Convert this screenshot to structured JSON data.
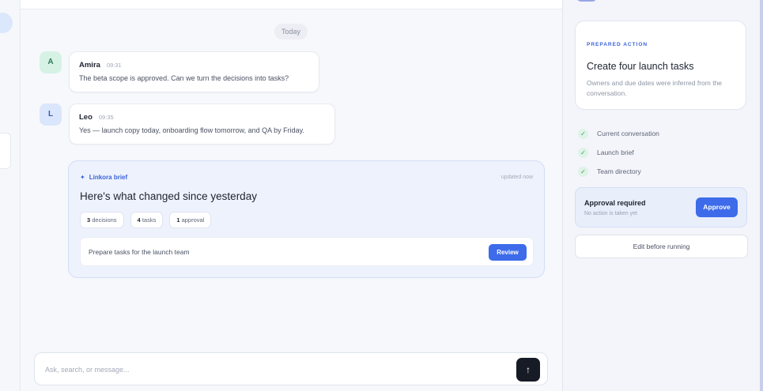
{
  "chat": {
    "day_label": "Today",
    "messages": [
      {
        "avatar": "A",
        "name": "Amira",
        "time": "09:31",
        "text": "The beta scope is approved. Can we turn the decisions into tasks?"
      },
      {
        "avatar": "L",
        "name": "Leo",
        "time": "09:35",
        "text": "Yes — launch copy today, onboarding flow tomorrow, and QA by Friday."
      }
    ],
    "brief": {
      "icon": "sparkle-icon",
      "label": "Linkora brief",
      "updated": "updated now",
      "title": "Here's what changed since yesterday",
      "chips": [
        {
          "count": "3",
          "label": "decisions"
        },
        {
          "count": "4",
          "label": "tasks"
        },
        {
          "count": "1",
          "label": "approval"
        }
      ],
      "action_text": "Prepare tasks for the launch team",
      "review_label": "Review"
    },
    "composer": {
      "placeholder": "Ask, search, or message...",
      "send_icon": "arrow-up-icon"
    }
  },
  "side_panel": {
    "prepared": {
      "label": "PREPARED ACTION",
      "title": "Create four launch tasks",
      "description": "Owners and due dates were inferred from the conversation."
    },
    "sources": [
      {
        "icon": "check-icon",
        "label": "Current conversation"
      },
      {
        "icon": "check-icon",
        "label": "Launch brief"
      },
      {
        "icon": "check-icon",
        "label": "Team directory"
      }
    ],
    "approval": {
      "title": "Approval required",
      "subtitle": "No action is taken yet",
      "approve_label": "Approve"
    },
    "edit_label": "Edit before running"
  },
  "colors": {
    "accent": "#3d6bea",
    "send_button": "#161b26",
    "check": "#3c9a66"
  }
}
